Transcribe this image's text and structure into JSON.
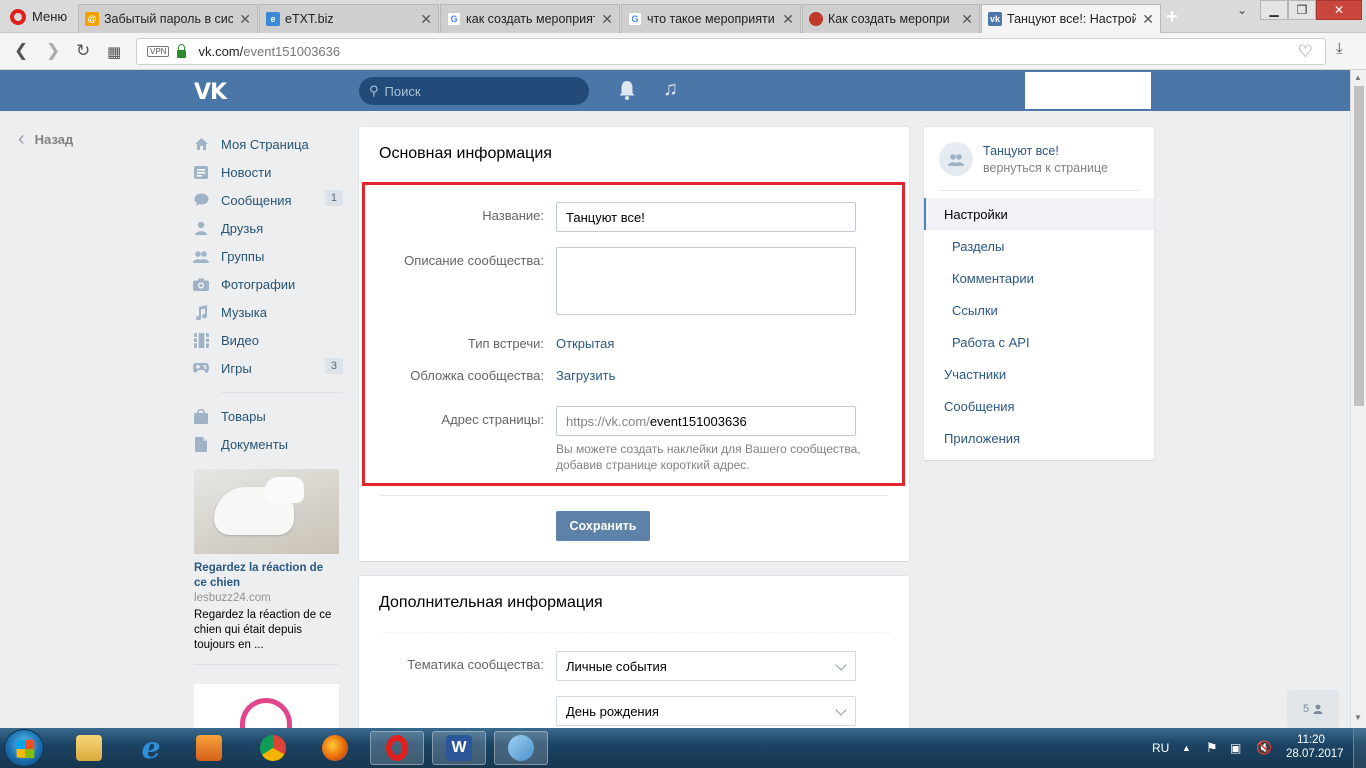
{
  "browser": {
    "menu_label": "Меню",
    "tabs": [
      {
        "title": "Забытый пароль в сист",
        "fav_color": "#f0a000"
      },
      {
        "title": "eTXT.biz",
        "fav_color": "#3a88d8"
      },
      {
        "title": "как создать мероприят",
        "fav_color": "#4285f4"
      },
      {
        "title": "что такое мероприяти",
        "fav_color": "#4285f4"
      },
      {
        "title": "Как создать меропри",
        "fav_color": "#c0392b"
      },
      {
        "title": "Танцуют все!: Настрой",
        "fav_color": "#4a76a8"
      }
    ],
    "url_prefix": "vk.com/",
    "url_path": "event151003636",
    "vpn_label": "VPN"
  },
  "header": {
    "logo_text": "VK",
    "search_placeholder": "Поиск"
  },
  "back_label": "Назад",
  "sidebar": {
    "items": [
      {
        "label": "Моя Страница",
        "icon": "home-icon"
      },
      {
        "label": "Новости",
        "icon": "news-icon"
      },
      {
        "label": "Сообщения",
        "icon": "messages-icon",
        "count": "1"
      },
      {
        "label": "Друзья",
        "icon": "friends-icon"
      },
      {
        "label": "Группы",
        "icon": "groups-icon"
      },
      {
        "label": "Фотографии",
        "icon": "camera-icon"
      },
      {
        "label": "Музыка",
        "icon": "music-icon"
      },
      {
        "label": "Видео",
        "icon": "video-icon"
      },
      {
        "label": "Игры",
        "icon": "games-icon",
        "count": "3"
      }
    ],
    "extra_items": [
      {
        "label": "Товары",
        "icon": "shopping-bag-icon"
      },
      {
        "label": "Документы",
        "icon": "document-icon"
      }
    ]
  },
  "ad": {
    "title": "Regardez la réaction de ce chien",
    "domain": "lesbuzz24.com",
    "text": "Regardez la réaction de ce chien qui était depuis toujours en ..."
  },
  "main_info": {
    "title": "Основная информация",
    "name_label": "Название:",
    "name_value": "Танцуют все!",
    "desc_label": "Описание сообщества:",
    "desc_value": "",
    "type_label": "Тип встречи:",
    "type_value": "Открытая",
    "cover_label": "Обложка сообщества:",
    "cover_value": "Загрузить",
    "address_label": "Адрес страницы:",
    "address_prefix": "https://vk.com/",
    "address_value": "event151003636",
    "address_hint": "Вы можете создать наклейки для Вашего сообщества, добавив странице короткий адрес.",
    "save_label": "Сохранить"
  },
  "extra_info": {
    "title": "Дополнительная информация",
    "topic_label": "Тематика сообщества:",
    "topic_value": "Личные события",
    "subtopic_value": "День рождения"
  },
  "right_menu": {
    "group_name": "Танцуют все!",
    "back_to_page": "вернуться к странице",
    "items": [
      {
        "label": "Настройки",
        "selected": true,
        "indent": false
      },
      {
        "label": "Разделы",
        "selected": false,
        "indent": true
      },
      {
        "label": "Комментарии",
        "selected": false,
        "indent": true
      },
      {
        "label": "Ссылки",
        "selected": false,
        "indent": true
      },
      {
        "label": "Работа с API",
        "selected": false,
        "indent": true
      },
      {
        "label": "Участники",
        "selected": false,
        "indent": false
      },
      {
        "label": "Сообщения",
        "selected": false,
        "indent": false
      },
      {
        "label": "Приложения",
        "selected": false,
        "indent": false
      }
    ]
  },
  "online_count": "5",
  "taskbar": {
    "lang": "RU",
    "time": "11:20",
    "date": "28.07.2017"
  },
  "colors": {
    "vk_blue": "#4a76a8",
    "highlight_red": "#e0252c",
    "link": "#2a5885"
  }
}
